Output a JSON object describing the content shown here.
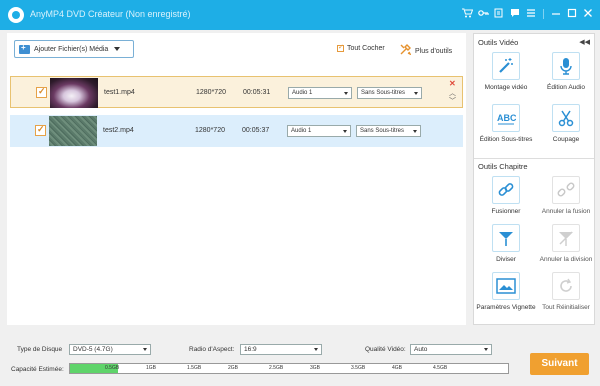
{
  "titlebar": {
    "app_name": "AnyMP4 DVD Créateur (Non enregistré)",
    "icons": [
      "cart-icon",
      "key-icon",
      "register-icon",
      "feedback-icon",
      "menu-icon",
      "minimize-icon",
      "maximize-icon",
      "close-icon"
    ]
  },
  "toolbar": {
    "add_files_label": "Ajouter Fichier(s) Média",
    "check_all_label": "Tout Cocher",
    "more_tools_label": "Plus d'outils"
  },
  "files": [
    {
      "checked": true,
      "name": "test1.mp4",
      "resolution": "1280*720",
      "duration": "00:05:31",
      "audio": "Audio 1",
      "subtitle": "Sans Sous-titres",
      "selected": true
    },
    {
      "checked": true,
      "name": "test2.mp4",
      "resolution": "1280*720",
      "duration": "00:05:37",
      "audio": "Audio 1",
      "subtitle": "Sans Sous-titres",
      "selected": false
    }
  ],
  "video_tools": {
    "title": "Outils Vidéo",
    "items": [
      {
        "label": "Montage vidéo",
        "icon": "magic-wand-icon",
        "enabled": true
      },
      {
        "label": "Édition Audio",
        "icon": "microphone-icon",
        "enabled": true
      },
      {
        "label": "Édition Sous-titres",
        "icon": "subtitle-abc-icon",
        "enabled": true
      },
      {
        "label": "Coupage",
        "icon": "scissors-icon",
        "enabled": true
      }
    ]
  },
  "chapter_tools": {
    "title": "Outils Chapitre",
    "items": [
      {
        "label": "Fusionner",
        "icon": "link-icon",
        "enabled": true
      },
      {
        "label": "Annuler la fusion",
        "icon": "unlink-icon",
        "enabled": false
      },
      {
        "label": "Diviser",
        "icon": "split-icon",
        "enabled": true
      },
      {
        "label": "Annuler la division",
        "icon": "unsplit-icon",
        "enabled": false
      },
      {
        "label": "Paramètres Vignette",
        "icon": "thumbnail-icon",
        "enabled": true
      },
      {
        "label": "Tout Réinitialiser",
        "icon": "reset-icon",
        "enabled": false
      }
    ]
  },
  "bottom": {
    "disc_type_label": "Type de Disque",
    "disc_type_value": "DVD-5 (4.7G)",
    "aspect_label": "Radio d'Aspect:",
    "aspect_value": "16:9",
    "quality_label": "Qualité Vidéo:",
    "quality_value": "Auto",
    "capacity_label": "Capacité Estimée:",
    "capacity_fill_fraction": 0.11,
    "capacity_ticks": [
      "0.5GB",
      "1GB",
      "1.5GB",
      "2GB",
      "2.5GB",
      "3GB",
      "3.5GB",
      "4GB",
      "4.5GB"
    ],
    "next_label": "Suivant"
  },
  "colors": {
    "accent_blue": "#1eaee6",
    "selected_row": "#fbf1dc",
    "second_row": "#dceefc",
    "next_button": "#f0a030",
    "capacity_fill": "#5fd46a"
  }
}
